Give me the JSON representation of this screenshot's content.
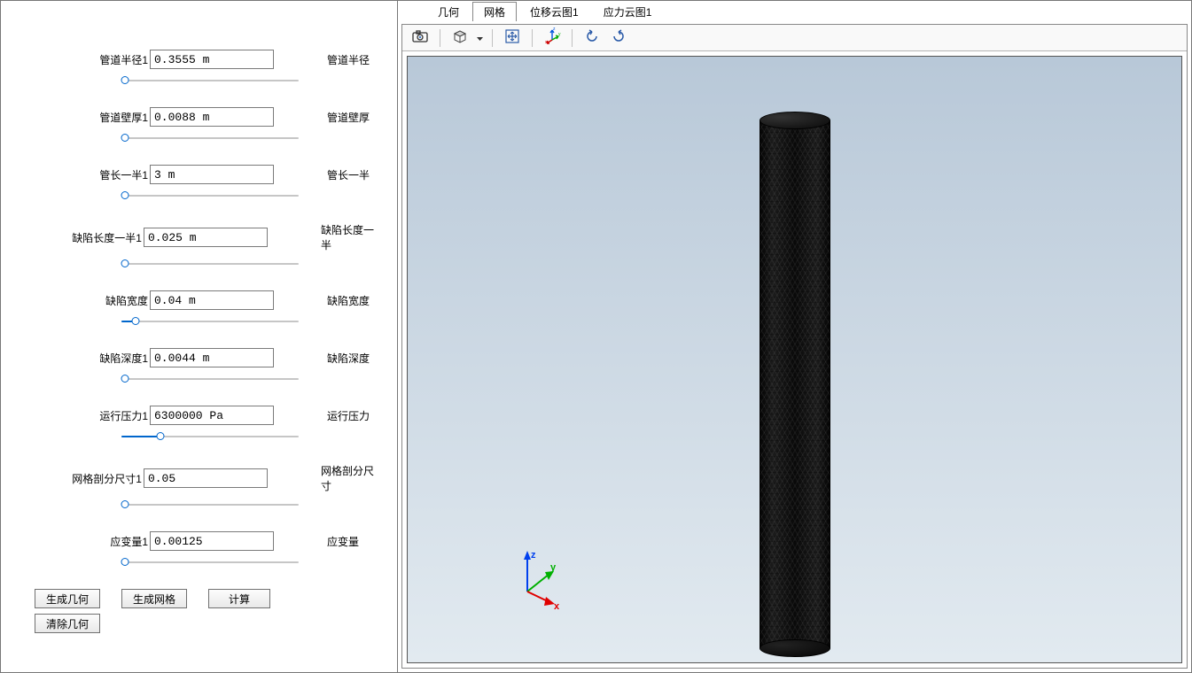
{
  "params": [
    {
      "labelL": "管道半径1",
      "value": "0.3555 m",
      "labelR": "管道半径",
      "slider": 2
    },
    {
      "labelL": "管道壁厚1",
      "value": "0.0088 m",
      "labelR": "管道壁厚",
      "slider": 2
    },
    {
      "labelL": "管长一半1",
      "value": "3 m",
      "labelR": "管长一半",
      "slider": 2
    },
    {
      "labelL": "缺陷长度一半1",
      "value": "0.025 m",
      "labelR": "缺陷长度一半",
      "slider": 2
    },
    {
      "labelL": "缺陷宽度",
      "value": "0.04 m",
      "labelR": "缺陷宽度",
      "slider": 8
    },
    {
      "labelL": "缺陷深度1",
      "value": "0.0044 m",
      "labelR": "缺陷深度",
      "slider": 2
    },
    {
      "labelL": "运行压力1",
      "value": "6300000 Pa",
      "labelR": "运行压力",
      "slider": 22
    },
    {
      "labelL": "网格剖分尺寸1",
      "value": "0.05",
      "labelR": "网格剖分尺寸",
      "slider": 2
    },
    {
      "labelL": "应变量1",
      "value": "0.00125",
      "labelR": "应变量",
      "slider": 2
    }
  ],
  "buttons": {
    "genGeom": "生成几何",
    "genMesh": "生成网格",
    "compute": "计算",
    "clearGeom": "清除几何"
  },
  "tabs": [
    "几何",
    "网格",
    "位移云图1",
    "应力云图1"
  ],
  "activeTab": 1,
  "triad": {
    "x": "x",
    "y": "y",
    "z": "z"
  }
}
